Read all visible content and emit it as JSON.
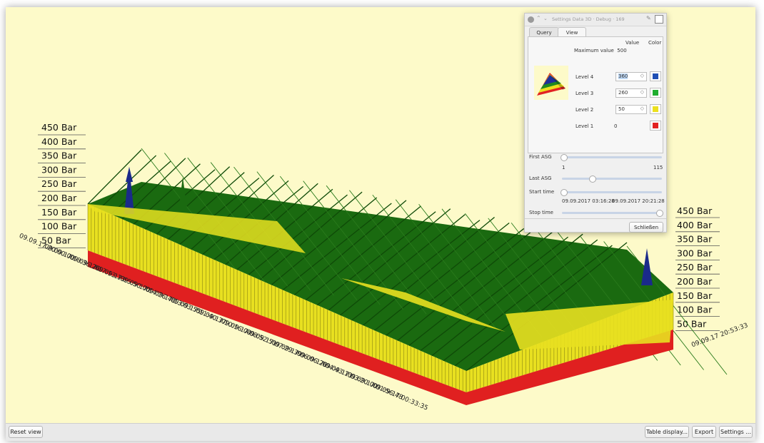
{
  "chart": {
    "type": "surface-3d",
    "left_axis_labels": [
      "450 Bar",
      "400 Bar",
      "350 Bar",
      "300 Bar",
      "250 Bar",
      "200 Bar",
      "150 Bar",
      "100 Bar",
      "50 Bar"
    ],
    "right_axis_labels": [
      "450 Bar",
      "400 Bar",
      "350 Bar",
      "300 Bar",
      "250 Bar",
      "200 Bar",
      "150 Bar",
      "100 Bar",
      "50 Bar"
    ],
    "time_labels": [
      "09.09.17 00:33:35",
      "09.09.17 01:56:48",
      "09.09.17 03:20:00",
      "09.09.17 04:43:13",
      "09.09.17 06:06:26",
      "09.09.17 07:29:39",
      "09.09.17 08:52:51",
      "09.09.17 10:16:04",
      "09.09.17 11:40:37",
      "09.09.17 13:03:55",
      "09.09.17 14:26:48",
      "09.09.17 15:50:00",
      "09.09.17 17:13:13",
      "09.09.17 18:36:26",
      "09.09.17 20:00:00"
    ],
    "right_time_label": "09.09.17 20:53:33",
    "level_colors": {
      "level1": "#e02020",
      "level2": "#e8e020",
      "level3": "#1a6a10",
      "level4": "#1a2a8a"
    }
  },
  "dialog": {
    "title": "Settings Data 3D · Debug · 169",
    "tabs": [
      {
        "label": "Query",
        "active": false
      },
      {
        "label": "View",
        "active": true
      }
    ],
    "col_value": "Value",
    "col_color": "Color",
    "max_value_label": "Maximum value",
    "max_value": "500",
    "levels": [
      {
        "name": "Level 4",
        "value": "360",
        "color": "#1f4fb5",
        "editable": true,
        "selected": true
      },
      {
        "name": "Level 3",
        "value": "260",
        "color": "#1fae2f",
        "editable": true,
        "selected": false
      },
      {
        "name": "Level 2",
        "value": "50",
        "color": "#ece01f",
        "editable": true,
        "selected": false
      },
      {
        "name": "Level 1",
        "value": "0",
        "color": "#e22222",
        "editable": false,
        "selected": false
      }
    ],
    "first_asg_label": "First ASG",
    "first_asg_min": "1",
    "first_asg_max": "115",
    "first_asg_value": 0.0,
    "last_asg_label": "Last ASG",
    "last_asg_value": 0.3,
    "start_time_label": "Start time",
    "start_time_value": 0.0,
    "time_start": "09.09.2017 03:16:28",
    "time_end": "09.09.2017 20:21:28",
    "stop_time_label": "Stop time",
    "stop_time_value": 1.0,
    "close_label": "Schließen"
  },
  "bottom_bar": {
    "reset_view": "Reset view",
    "table_display": "Table display...",
    "export": "Export",
    "settings": "Settings ..."
  }
}
